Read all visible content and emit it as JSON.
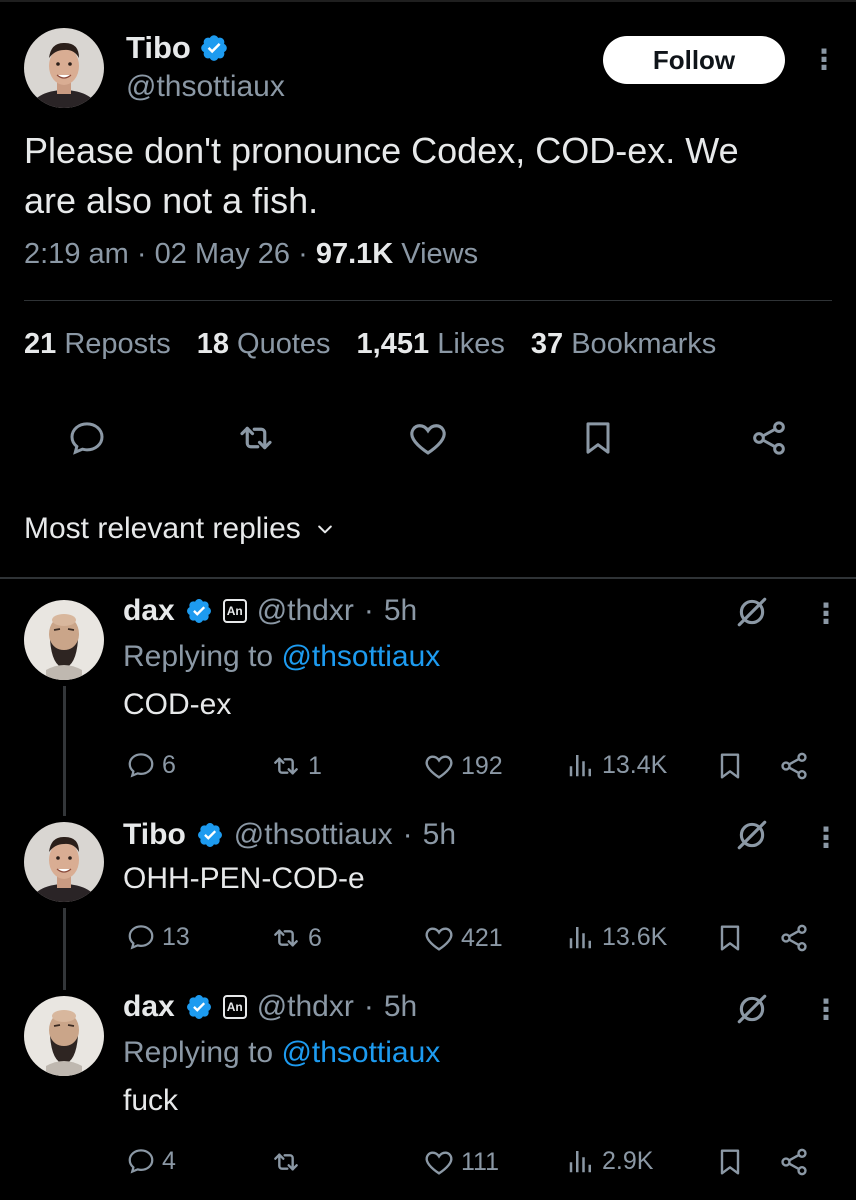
{
  "tweet": {
    "author_name": "Tibo",
    "author_handle": "@thsottiaux",
    "follow_label": "Follow",
    "text_line1": "Please don't pronounce Codex, COD-ex. We",
    "text_line2": "are also not a fish.",
    "time": "2:19 am",
    "date": "02 May 26",
    "views_count": "97.1K",
    "views_label": "Views",
    "reposts_count": "21",
    "reposts_label": "Reposts",
    "quotes_count": "18",
    "quotes_label": "Quotes",
    "likes_count": "1,451",
    "likes_label": "Likes",
    "bookmarks_count": "37",
    "bookmarks_label": "Bookmarks",
    "verified_color": "#1d9bf0"
  },
  "replies_header": {
    "label": "Most relevant replies"
  },
  "replies": [
    {
      "name": "dax",
      "handle": "@thdxr",
      "time": "5h",
      "badge": "An",
      "replying_prefix": "Replying to",
      "replying_handle": "@thsottiaux",
      "text": "COD-ex",
      "comments": "6",
      "reposts": "1",
      "likes": "192",
      "views": "13.4K"
    },
    {
      "name": "Tibo",
      "handle": "@thsottiaux",
      "time": "5h",
      "text": "OHH-PEN-COD-e",
      "comments": "13",
      "reposts": "6",
      "likes": "421",
      "views": "13.6K"
    },
    {
      "name": "dax",
      "handle": "@thdxr",
      "time": "5h",
      "badge": "An",
      "replying_prefix": "Replying to",
      "replying_handle": "@thsottiaux",
      "text": "fuck",
      "comments": "4",
      "reposts": "",
      "likes": "111",
      "views": "2.9K"
    }
  ],
  "separator": "·"
}
